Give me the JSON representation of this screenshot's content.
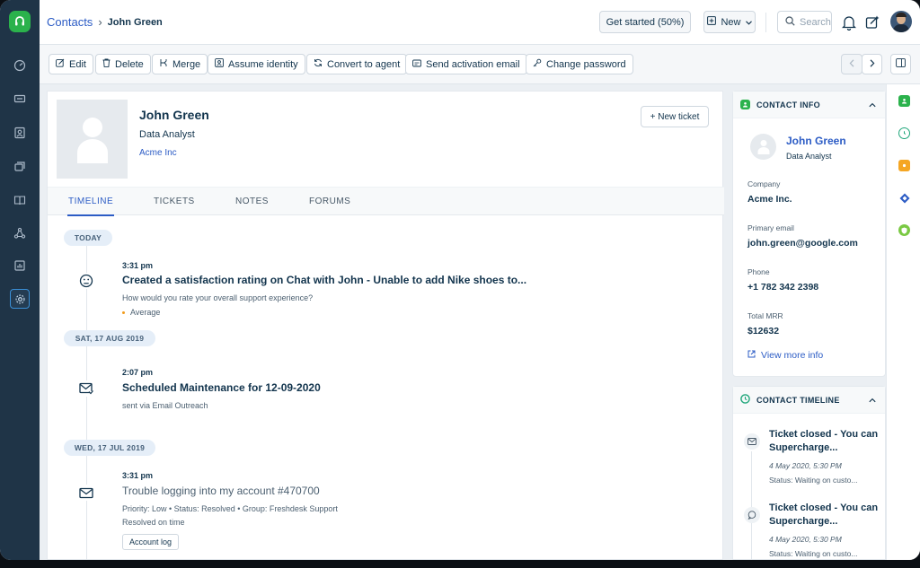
{
  "breadcrumb": {
    "root": "Contacts",
    "separator": "›",
    "current": "John Green"
  },
  "header": {
    "get_started": "Get started (50%)",
    "new_label": "New",
    "search_placeholder": "Search"
  },
  "toolbar": {
    "edit": "Edit",
    "delete": "Delete",
    "merge": "Merge",
    "assume_identity": "Assume identity",
    "convert_to_agent": "Convert to agent",
    "send_activation_email": "Send activation email",
    "change_password": "Change password"
  },
  "contact": {
    "name": "John Green",
    "title": "Data Analyst",
    "company": "Acme Inc",
    "new_ticket": "+ New ticket"
  },
  "tabs": [
    "TIMELINE",
    "TICKETS",
    "NOTES",
    "FORUMS"
  ],
  "timeline": {
    "groups": [
      {
        "date": "TODAY",
        "events": [
          {
            "time": "3:31 pm",
            "title": "Created a satisfaction rating on Chat with John - Unable to add Nike shoes to...",
            "sub1": "How would you rate your overall support experience?",
            "rating": "Average"
          }
        ]
      },
      {
        "date": "SAT, 17 AUG 2019",
        "events": [
          {
            "time": "2:07 pm",
            "title": "Scheduled Maintenance for 12-09-2020",
            "sub1": "sent via Email Outreach"
          }
        ]
      },
      {
        "date": "WED, 17 JUL 2019",
        "events": [
          {
            "time": "3:31 pm",
            "title": "Trouble logging into my account #470700",
            "sub1": "Priority: Low  •  Status: Resolved  •  Group: Freshdesk Support",
            "sub2": "Resolved on time",
            "button": "Account log"
          }
        ]
      }
    ]
  },
  "contact_info": {
    "heading": "CONTACT INFO",
    "name": "John Green",
    "title": "Data Analyst",
    "company_label": "Company",
    "company": "Acme Inc.",
    "email_label": "Primary email",
    "email": "john.green@google.com",
    "phone_label": "Phone",
    "phone": "+1 782 342 2398",
    "mrr_label": "Total MRR",
    "mrr": "$12632",
    "view_more": "View more info"
  },
  "contact_timeline": {
    "heading": "CONTACT TIMELINE",
    "items": [
      {
        "title": "Ticket closed - You can Supercharge...",
        "date": "4 May 2020, 5:30 PM",
        "status": "Status: Waiting on custo..."
      },
      {
        "title": "Ticket closed - You can Supercharge...",
        "date": "4 May 2020, 5:30 PM",
        "status": "Status: Waiting on custo..."
      }
    ]
  },
  "colors": {
    "brand_green": "#2bb24c",
    "nav_bg": "#1f3447",
    "link_blue": "#2c5cc5",
    "rail_icons": [
      "#2bb24c",
      "#1fa67a",
      "#f5a623",
      "#2c5cc5",
      "#7ac943"
    ]
  }
}
